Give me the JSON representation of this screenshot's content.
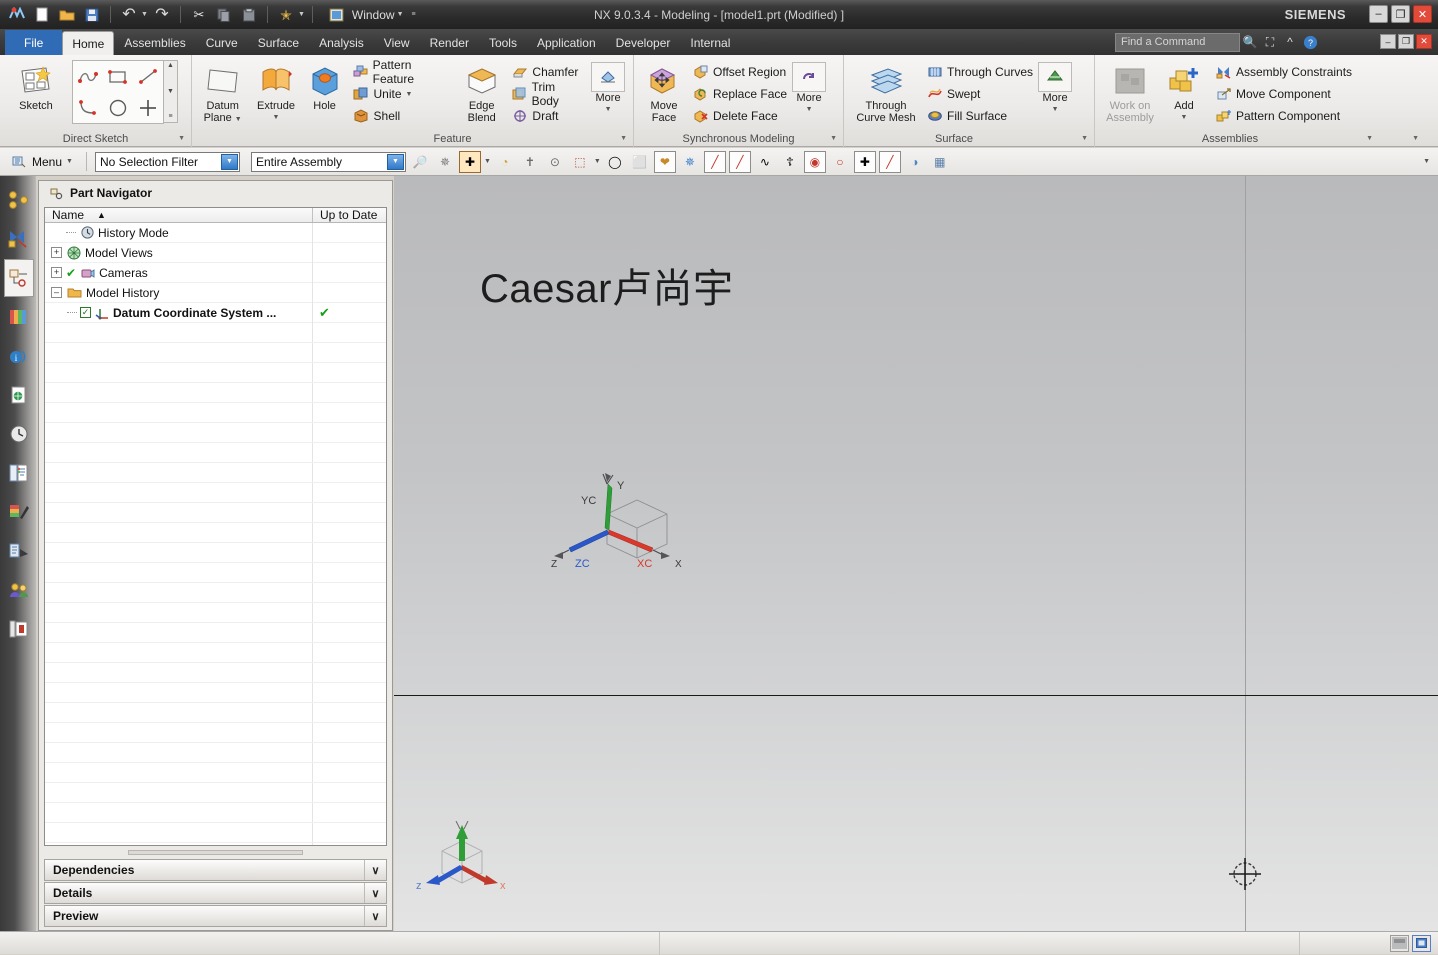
{
  "titlebar": {
    "title": "NX 9.0.3.4 - Modeling - [model1.prt (Modified) ]",
    "brand": "SIEMENS",
    "window_label": "Window",
    "quick_access": [
      {
        "name": "nx-logo-icon",
        "glyph": "❖"
      },
      {
        "name": "new-file-icon",
        "glyph": "⬜"
      },
      {
        "name": "open-folder-icon",
        "glyph": "📂"
      },
      {
        "name": "save-icon",
        "glyph": "💾"
      },
      {
        "name": "undo-icon",
        "glyph": "↶"
      },
      {
        "name": "redo-icon",
        "glyph": "↷"
      },
      {
        "name": "cut-icon",
        "glyph": "✂"
      },
      {
        "name": "copy-icon",
        "glyph": "⧉"
      },
      {
        "name": "paste-icon",
        "glyph": "▤"
      },
      {
        "name": "favorites-icon",
        "glyph": "⭐"
      }
    ],
    "window_buttons": [
      {
        "name": "minimize-button",
        "glyph": "–"
      },
      {
        "name": "restore-button",
        "glyph": "❐"
      },
      {
        "name": "close-button",
        "glyph": "✕"
      }
    ]
  },
  "tabs": [
    {
      "label": "File",
      "active": false,
      "kind": "file"
    },
    {
      "label": "Home",
      "active": true
    },
    {
      "label": "Assemblies",
      "active": false
    },
    {
      "label": "Curve",
      "active": false
    },
    {
      "label": "Surface",
      "active": false
    },
    {
      "label": "Analysis",
      "active": false
    },
    {
      "label": "View",
      "active": false
    },
    {
      "label": "Render",
      "active": false
    },
    {
      "label": "Tools",
      "active": false
    },
    {
      "label": "Application",
      "active": false
    },
    {
      "label": "Developer",
      "active": false
    },
    {
      "label": "Internal",
      "active": false
    }
  ],
  "search": {
    "placeholder": "Find a Command",
    "icons": [
      {
        "name": "search-icon",
        "glyph": "🔍"
      },
      {
        "name": "fullscreen-icon",
        "glyph": "⛶"
      },
      {
        "name": "collapse-ribbon-icon",
        "glyph": "⌃"
      },
      {
        "name": "help-icon",
        "glyph": "?"
      }
    ],
    "mini_buttons": [
      {
        "name": "doc-minimize-button",
        "glyph": "–"
      },
      {
        "name": "doc-restore-button",
        "glyph": "❐"
      },
      {
        "name": "doc-close-button",
        "glyph": "✕"
      }
    ]
  },
  "ribbon": {
    "groups": [
      {
        "name": "direct-sketch",
        "title": "Direct Sketch",
        "big": [
          {
            "label": "Sketch",
            "icon": "sketch-icon"
          }
        ],
        "grid": [
          {
            "name": "profile-icon"
          },
          {
            "name": "rectangle-icon"
          },
          {
            "name": "line-icon"
          },
          {
            "name": "arc-icon"
          },
          {
            "name": "circle-icon"
          },
          {
            "name": "quick-trim-icon"
          }
        ]
      },
      {
        "name": "feature-datum",
        "title": "",
        "big": [
          {
            "label": "Datum\nPlane",
            "icon": "datum-plane-icon",
            "dropdown": true
          },
          {
            "label": "Extrude",
            "icon": "extrude-icon",
            "dropdown": true
          },
          {
            "label": "Hole",
            "icon": "hole-icon"
          }
        ]
      },
      {
        "name": "feature",
        "title": "Feature",
        "small_left": [
          {
            "label": "Pattern Feature",
            "icon": "pattern-feature-icon"
          },
          {
            "label": "Unite",
            "icon": "unite-icon",
            "dropdown": true
          },
          {
            "label": "Shell",
            "icon": "shell-icon"
          }
        ],
        "big": [
          {
            "label": "Edge\nBlend",
            "icon": "edge-blend-icon"
          }
        ],
        "small_right": [
          {
            "label": "Chamfer",
            "icon": "chamfer-icon"
          },
          {
            "label": "Trim Body",
            "icon": "trim-body-icon"
          },
          {
            "label": "Draft",
            "icon": "draft-icon"
          }
        ],
        "more": {
          "label": "More",
          "icon": "more-feature-icon"
        }
      },
      {
        "name": "synchronous-modeling",
        "title": "Synchronous Modeling",
        "big": [
          {
            "label": "Move\nFace",
            "icon": "move-face-icon"
          }
        ],
        "small_right": [
          {
            "label": "Offset Region",
            "icon": "offset-region-icon"
          },
          {
            "label": "Replace Face",
            "icon": "replace-face-icon"
          },
          {
            "label": "Delete Face",
            "icon": "delete-face-icon"
          }
        ],
        "more": {
          "label": "More",
          "icon": "more-sync-icon"
        }
      },
      {
        "name": "surface",
        "title": "Surface",
        "big": [
          {
            "label": "Through\nCurve Mesh",
            "icon": "through-curve-mesh-icon"
          }
        ],
        "small_right": [
          {
            "label": "Through Curves",
            "icon": "through-curves-icon"
          },
          {
            "label": "Swept",
            "icon": "swept-icon"
          },
          {
            "label": "Fill Surface",
            "icon": "fill-surface-icon"
          }
        ],
        "more": {
          "label": "More",
          "icon": "more-surface-icon"
        }
      },
      {
        "name": "assemblies",
        "title": "Assemblies",
        "big": [
          {
            "label": "Work on\nAssembly",
            "icon": "work-on-assembly-icon",
            "disabled": true
          },
          {
            "label": "Add",
            "icon": "add-component-icon",
            "dropdown": true
          }
        ],
        "small_right": [
          {
            "label": "Assembly Constraints",
            "icon": "assembly-constraints-icon"
          },
          {
            "label": "Move Component",
            "icon": "move-component-icon"
          },
          {
            "label": "Pattern Component",
            "icon": "pattern-component-icon"
          }
        ]
      }
    ]
  },
  "selection_toolbar": {
    "menu_label": "Menu",
    "filter_value": "No Selection Filter",
    "scope_value": "Entire Assembly",
    "icons": [
      {
        "name": "find-object-icon",
        "glyph": "🔎"
      },
      {
        "name": "selection-priority-icon",
        "glyph": "✵"
      },
      {
        "name": "snap-point-icon",
        "glyph": "✚",
        "state": "selected"
      },
      {
        "name": "enable-snap-icon",
        "glyph": "◔"
      },
      {
        "name": "point-on-curve-icon",
        "glyph": "⊕"
      },
      {
        "name": "point-on-face-icon",
        "glyph": "⊙"
      },
      {
        "name": "rectangle-select-icon",
        "glyph": "⬚"
      },
      {
        "name": "face-select-icon",
        "glyph": "◧"
      },
      {
        "name": "solid-body-icon",
        "glyph": "⬛"
      },
      {
        "name": "move-object-icon",
        "glyph": "✤",
        "state": "boxed"
      },
      {
        "name": "transform-icon",
        "glyph": "✥"
      },
      {
        "name": "line-endpoint-icon",
        "glyph": "╱",
        "state": "boxed"
      },
      {
        "name": "line-midpoint-icon",
        "glyph": "╲",
        "state": "boxed"
      },
      {
        "name": "curve-snap-icon",
        "glyph": "∿"
      },
      {
        "name": "intersection-icon",
        "glyph": "⑂"
      },
      {
        "name": "arc-center-icon",
        "glyph": "⊙",
        "state": "boxed"
      },
      {
        "name": "quadrant-point-icon",
        "glyph": "○"
      },
      {
        "name": "point-constructor-icon",
        "glyph": "✚",
        "state": "boxed"
      },
      {
        "name": "tangent-point-icon",
        "glyph": "╱",
        "state": "boxed"
      },
      {
        "name": "bounding-box-icon",
        "glyph": "◑"
      },
      {
        "name": "grid-snap-icon",
        "glyph": "▦"
      }
    ]
  },
  "resource_bar": {
    "items": [
      {
        "name": "assembly-navigator-icon",
        "glyph": "⚭",
        "active": false
      },
      {
        "name": "constraint-navigator-icon",
        "glyph": "⬡",
        "active": false
      },
      {
        "name": "part-navigator-icon",
        "glyph": "▣",
        "active": true
      },
      {
        "name": "reuse-library-icon",
        "glyph": "☰",
        "active": false
      },
      {
        "name": "hd3d-tools-icon",
        "glyph": "ⓘ",
        "active": false
      },
      {
        "name": "web-browser-icon",
        "glyph": "⎈",
        "active": false
      },
      {
        "name": "history-icon",
        "glyph": "◴",
        "active": false
      },
      {
        "name": "process-studio-icon",
        "glyph": "☷",
        "active": false
      },
      {
        "name": "system-materials-icon",
        "glyph": "◨",
        "active": false
      },
      {
        "name": "system-scene-icon",
        "glyph": "◩",
        "active": false
      },
      {
        "name": "roles-icon",
        "glyph": "♟",
        "active": false
      },
      {
        "name": "system-visual-icon",
        "glyph": "▧",
        "active": false
      }
    ]
  },
  "part_navigator": {
    "title": "Part Navigator",
    "columns": [
      "Name",
      "Up to Date"
    ],
    "sort_indicator": "▲",
    "rows": [
      {
        "label": "History Mode",
        "icon": "clock-icon",
        "indent": 0,
        "expander": "",
        "leader": true,
        "check": false,
        "uptodate": ""
      },
      {
        "label": "Model Views",
        "icon": "model-views-icon",
        "indent": 0,
        "expander": "+",
        "check": false,
        "uptodate": ""
      },
      {
        "label": "Cameras",
        "icon": "cameras-icon",
        "indent": 0,
        "expander": "+",
        "check": false,
        "mark": "✔",
        "uptodate": ""
      },
      {
        "label": "Model History",
        "icon": "folder-icon",
        "indent": 0,
        "expander": "–",
        "check": false,
        "uptodate": ""
      },
      {
        "label": "Datum Coordinate System ...",
        "icon": "datum-csys-icon",
        "indent": 1,
        "expander": "",
        "leader": true,
        "check": true,
        "uptodate": "✔"
      }
    ],
    "accordion": [
      {
        "label": "Dependencies",
        "chevron": "∨"
      },
      {
        "label": "Details",
        "chevron": "∨"
      },
      {
        "label": "Preview",
        "chevron": "∨"
      }
    ]
  },
  "viewport": {
    "annotation": "Caesar卢尚宇",
    "wcs_triad": {
      "labels": [
        "Y",
        "YC",
        "ZC",
        "Z",
        "XC",
        "X"
      ],
      "colors": {
        "x": "#d93a2b",
        "y": "#1f9b28",
        "z": "#2a58c8"
      }
    },
    "corner_triad": {
      "labels": [
        "Y",
        "Z",
        "X"
      ]
    }
  },
  "statusbar": {
    "icons": [
      {
        "name": "render-style-icon",
        "glyph": "▤"
      },
      {
        "name": "fullscreen-toggle-icon",
        "glyph": "⛶"
      }
    ]
  }
}
